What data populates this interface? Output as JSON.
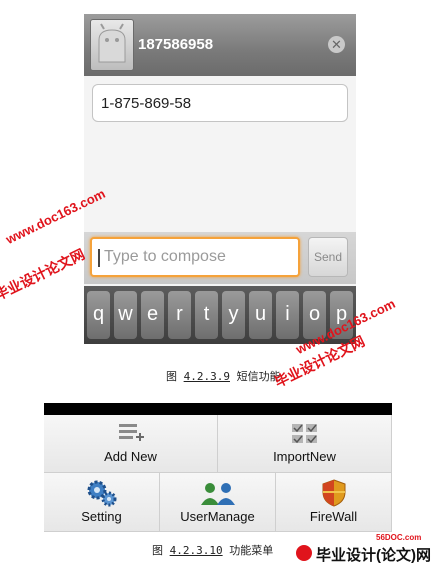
{
  "sms": {
    "contact_number": "187586958",
    "message_text": "1-875-869-58",
    "compose_placeholder": "Type to compose",
    "send_label": "Send",
    "keyboard_keys": [
      "q",
      "w",
      "e",
      "r",
      "t",
      "y",
      "u",
      "i",
      "o",
      "p"
    ],
    "caption": {
      "prefix": "图 ",
      "number": "4.2.3.9",
      "title": " 短信功能"
    }
  },
  "menu": {
    "items": [
      {
        "label": "Add New",
        "icon": "add-list-icon"
      },
      {
        "label": "ImportNew",
        "icon": "checklist-icon"
      },
      {
        "label": "Setting",
        "icon": "gears-icon"
      },
      {
        "label": "UserManage",
        "icon": "users-icon"
      },
      {
        "label": "FireWall",
        "icon": "shield-icon"
      }
    ],
    "caption": {
      "prefix": "图 ",
      "number": "4.2.3.10",
      "title": " 功能菜单"
    }
  },
  "watermarks": {
    "site": "www.doc163.com",
    "brand": "毕业设计论文网"
  },
  "footer": {
    "site": "56DOC.com",
    "brand": "毕业设计(论文)网"
  },
  "colors": {
    "watermark": "#e0141c",
    "compose_focus": "#f5a23a",
    "header_gray": "#7a7a7a"
  }
}
